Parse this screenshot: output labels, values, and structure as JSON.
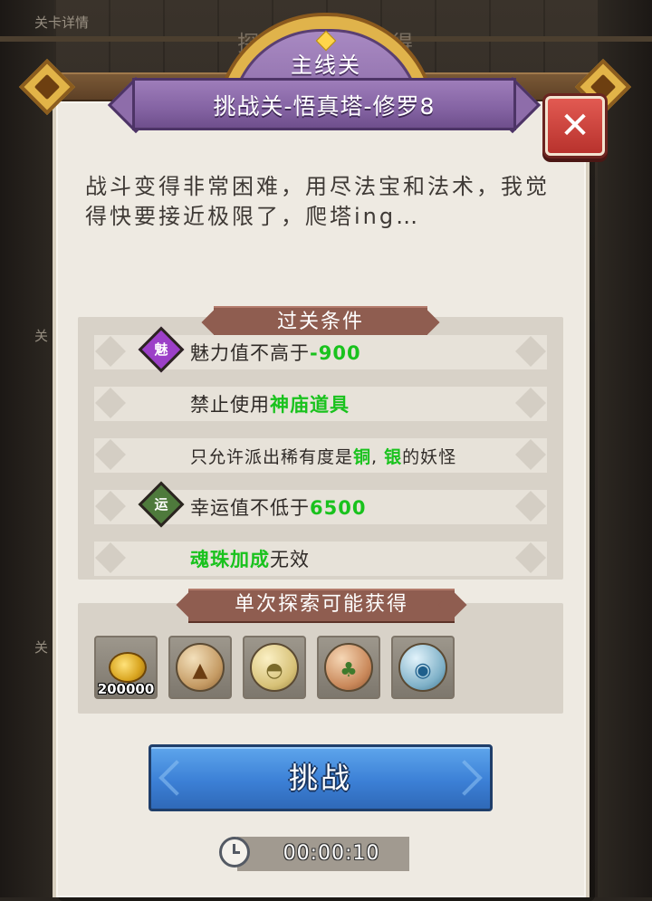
{
  "background": {
    "corner_label": "关卡详情",
    "tab_left": "探",
    "tab_right": "得",
    "side_label_1": "关",
    "side_label_2": "关"
  },
  "header": {
    "subtitle": "主线关",
    "title": "挑战关-悟真塔-修罗8",
    "close_symbol": "✕"
  },
  "description": "战斗变得非常困难，用尽法宝和法术，我觉得快要接近极限了，爬塔ing…",
  "conditions": {
    "heading": "过关条件",
    "items": [
      {
        "icon": "charm-icon",
        "icon_text": "魅",
        "prefix": "魅力值不高于",
        "highlight": "-900",
        "mid": "",
        "highlight2": "",
        "suffix": ""
      },
      {
        "icon": "",
        "icon_text": "",
        "prefix": "禁止使用",
        "highlight": "神庙道具",
        "mid": "",
        "highlight2": "",
        "suffix": ""
      },
      {
        "icon": "",
        "icon_text": "",
        "prefix": "只允许派出稀有度是",
        "highlight": "铜",
        "mid": ", ",
        "highlight2": "银",
        "suffix": "的妖怪"
      },
      {
        "icon": "luck-icon",
        "icon_text": "运",
        "prefix": "幸运值不低于",
        "highlight": "6500",
        "mid": "",
        "highlight2": "",
        "suffix": ""
      },
      {
        "icon": "",
        "icon_text": "",
        "prefix": "",
        "highlight": "魂珠加成",
        "mid": "",
        "highlight2": "",
        "suffix": "无效"
      }
    ]
  },
  "rewards": {
    "heading": "单次探索可能获得",
    "items": [
      {
        "name": "gold-coins-icon",
        "quantity": "200000",
        "color": "#7a5a34"
      },
      {
        "name": "earth-orb-icon",
        "quantity": "",
        "color": "#c49a63"
      },
      {
        "name": "bell-orb-icon",
        "quantity": "",
        "color": "#d7c177"
      },
      {
        "name": "wood-orb-icon",
        "quantity": "",
        "color": "#c9885a"
      },
      {
        "name": "water-orb-icon",
        "quantity": "",
        "color": "#7fb1c8"
      }
    ]
  },
  "challenge_button": "挑战",
  "timer": "00:00:10",
  "colors": {
    "highlight_green": "#19c21d",
    "title_purple": "#8463a3",
    "button_blue": "#3c80d6",
    "close_red": "#c93c35"
  }
}
